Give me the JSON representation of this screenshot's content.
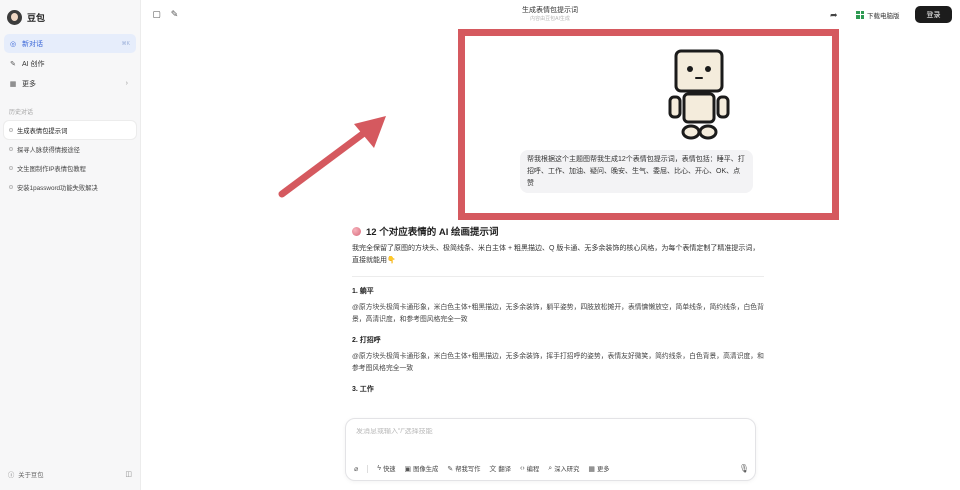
{
  "app": {
    "name": "豆包"
  },
  "sidebar": {
    "nav": [
      {
        "label": "新对话",
        "shortcut": "⌘K"
      },
      {
        "label": "AI 创作"
      },
      {
        "label": "更多"
      }
    ],
    "history_title": "历史对话",
    "history": [
      "生成表情包提示词",
      "探寻人脉获得情报途径",
      "文生图制作IP表情包教程",
      "安装1password功能失败解决"
    ],
    "footer": {
      "about": "关于豆包"
    }
  },
  "topbar": {
    "title": "生成表情包提示词",
    "subtitle": "内容由豆包AI生成",
    "download_label": "下载电脑版",
    "login_label": "登录"
  },
  "user_message": "帮我根据这个主题图帮我生成12个表情包提示词，表情包括：睡平、打招呼、工作、加油、疑问、晚安、生气、委屈、比心、开心、OK、点赞",
  "response": {
    "title": "12 个对应表情的 AI 绘画提示词",
    "intro": "我完全保留了原图的方块头、极简线条、米白主体 + 粗黑描边、Q 版卡通、无多余装饰的核心风格，为每个表情定制了精准提示词，直接就能用👇",
    "sections": [
      {
        "title": "1. 躺平",
        "body": "@原方块头极简卡通形象，米白色主体+粗黑描边，无多余装饰，躺平姿势，四肢放松摊开，表情慵懒放空，简单线条，简约线条，白色背景，高清识度，和参考图风格完全一致"
      },
      {
        "title": "2. 打招呼",
        "body": "@原方块头极简卡通形象，米白色主体+粗黑描边，无多余装饰，挥手打招呼的姿势，表情友好微笑，简约线条，白色背景，高清识度，和参考图风格完全一致"
      },
      {
        "title": "3. 工作",
        "body": ""
      }
    ]
  },
  "composer": {
    "placeholder": "发消息或输入“/”选择技能",
    "tools": [
      "快速",
      "图像生成",
      "帮我写作",
      "翻译",
      "编程",
      "深入研究",
      "更多"
    ]
  },
  "colors": {
    "highlight": "#d5595f",
    "arrow": "#d5595f",
    "active_nav": "#3b67d8"
  }
}
